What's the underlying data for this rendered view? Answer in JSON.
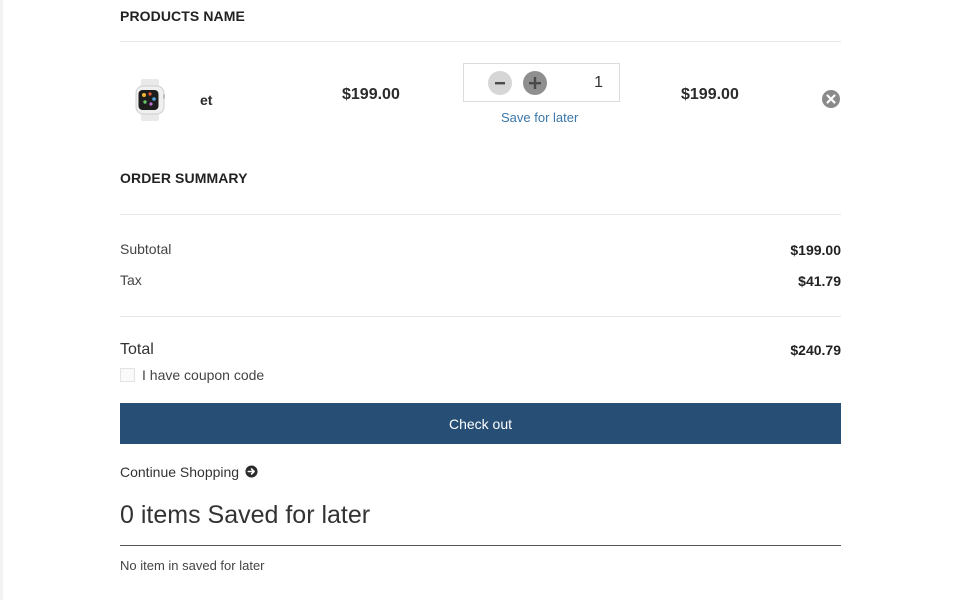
{
  "products": {
    "header": "PRODUCTS NAME",
    "items": [
      {
        "name": "et",
        "unit_price": "$199.00",
        "quantity": "1",
        "line_total": "$199.00",
        "save_for_later_label": "Save for later",
        "image_icon": "smartwatch-image"
      }
    ]
  },
  "summary": {
    "header": "ORDER SUMMARY",
    "subtotal_label": "Subtotal",
    "subtotal_value": "$199.00",
    "tax_label": "Tax",
    "tax_value": "$41.79",
    "total_label": "Total",
    "total_value": "$240.79",
    "coupon_label": "I have coupon code",
    "coupon_checked": false
  },
  "actions": {
    "checkout_label": "Check out",
    "continue_label": "Continue Shopping",
    "continue_icon": "circle-arrow-right-icon"
  },
  "saved_for_later": {
    "heading": "0 items Saved for later",
    "empty_message": "No item in saved for later"
  },
  "colors": {
    "accent": "#274f75",
    "link": "#3a77a8"
  }
}
